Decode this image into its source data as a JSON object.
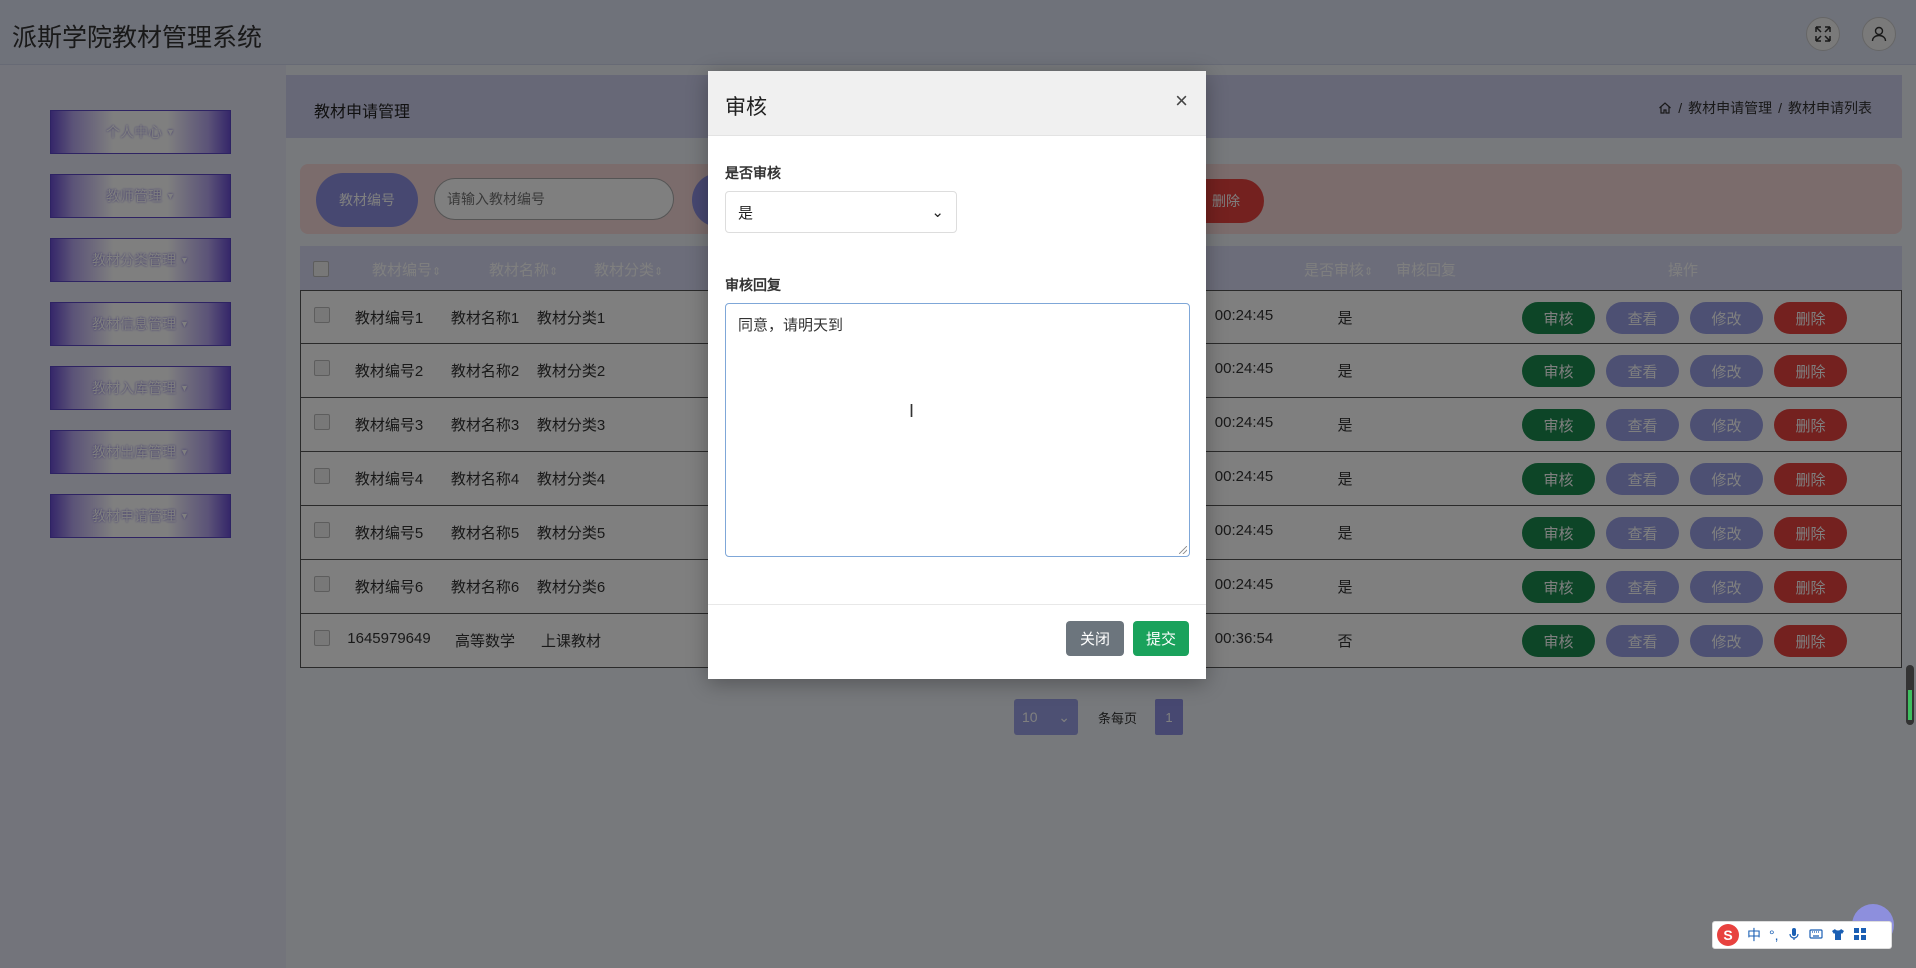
{
  "app": {
    "title": "派斯学院教材管理系统"
  },
  "header_icons": {
    "fullscreen": "expand-icon",
    "user": "user-icon"
  },
  "sidebar": {
    "items": [
      {
        "label": "个人中心"
      },
      {
        "label": "教师管理"
      },
      {
        "label": "教材分类管理"
      },
      {
        "label": "教材信息管理"
      },
      {
        "label": "教材入库管理"
      },
      {
        "label": "教材出库管理"
      },
      {
        "label": "教材申请管理"
      }
    ]
  },
  "page": {
    "section_title": "教材申请管理",
    "breadcrumb": {
      "item1": "教材申请管理",
      "item2": "教材申请列表",
      "separator": "/"
    }
  },
  "search": {
    "label": "教材编号",
    "placeholder": "请输入教材编号",
    "batch_delete_label": "删除"
  },
  "table": {
    "headers": {
      "code": "教材编号",
      "name": "教材名称",
      "category": "教材分类",
      "audited": "是否审核",
      "reply": "审核回复",
      "actions": "操作"
    },
    "rows": [
      {
        "code": "教材编号1",
        "name": "教材名称1",
        "category": "教材分类1",
        "time": "00:24:45",
        "audited": "是"
      },
      {
        "code": "教材编号2",
        "name": "教材名称2",
        "category": "教材分类2",
        "time": "00:24:45",
        "audited": "是"
      },
      {
        "code": "教材编号3",
        "name": "教材名称3",
        "category": "教材分类3",
        "time": "00:24:45",
        "audited": "是"
      },
      {
        "code": "教材编号4",
        "name": "教材名称4",
        "category": "教材分类4",
        "time": "00:24:45",
        "audited": "是"
      },
      {
        "code": "教材编号5",
        "name": "教材名称5",
        "category": "教材分类5",
        "time": "00:24:45",
        "audited": "是"
      },
      {
        "code": "教材编号6",
        "name": "教材名称6",
        "category": "教材分类6",
        "time": "00:24:45",
        "audited": "是"
      },
      {
        "code": "1645979649",
        "name": "高等数学",
        "category": "上课教材",
        "time": "00:36:54",
        "audited": "否"
      }
    ],
    "actions": {
      "audit": "审核",
      "view": "查看",
      "edit": "修改",
      "delete": "删除"
    }
  },
  "pagination": {
    "page_size": "10",
    "per_page_label": "条每页",
    "current_page": "1"
  },
  "modal": {
    "title": "审核",
    "close_symbol": "×",
    "audit_label": "是否审核",
    "audit_value": "是",
    "reply_label": "审核回复",
    "reply_value": "同意，请明天到",
    "close_button": "关闭",
    "submit_button": "提交"
  },
  "ime": {
    "logo": "S",
    "lang": "中",
    "punct": "°,"
  }
}
